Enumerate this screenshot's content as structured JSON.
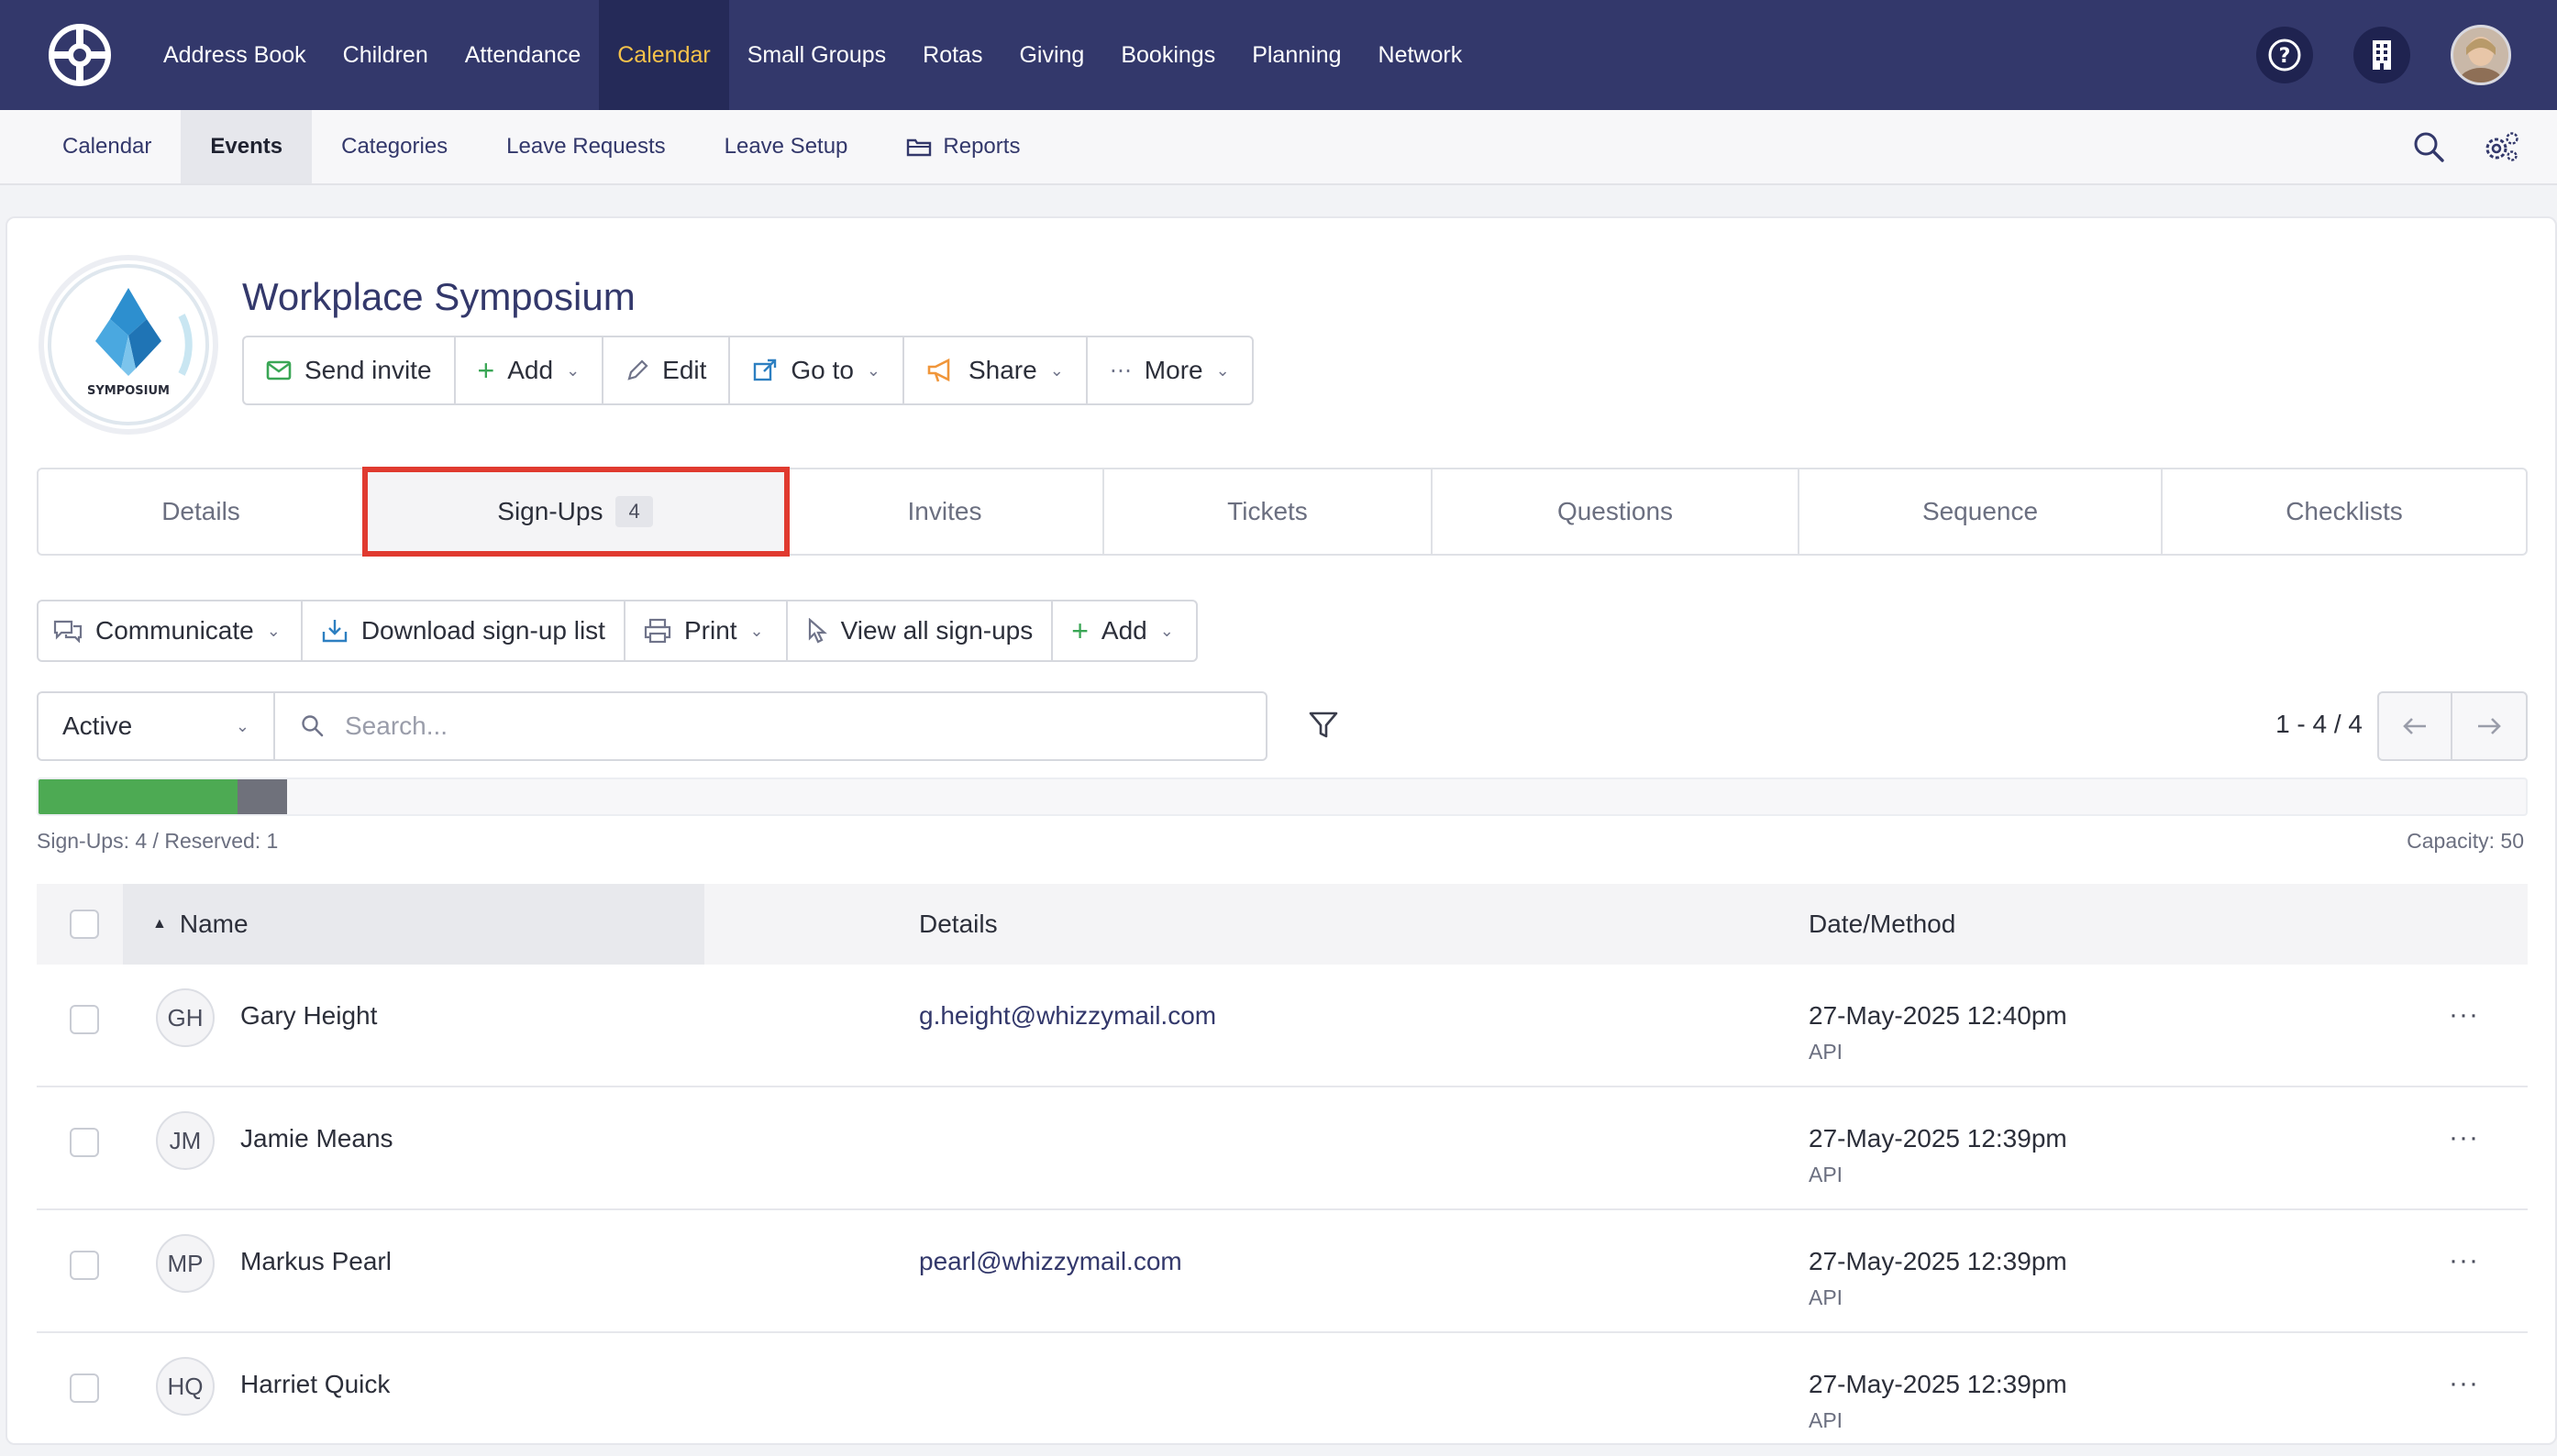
{
  "topnav": {
    "items": [
      "Address Book",
      "Children",
      "Attendance",
      "Calendar",
      "Small Groups",
      "Rotas",
      "Giving",
      "Bookings",
      "Planning",
      "Network"
    ],
    "active": "Calendar",
    "icons": [
      "help-icon",
      "building-icon",
      "user-avatar"
    ]
  },
  "subnav": {
    "items": [
      "Calendar",
      "Events",
      "Categories",
      "Leave Requests",
      "Leave Setup",
      "Reports"
    ],
    "active": "Events",
    "tools": [
      "search-icon",
      "settings-icon"
    ]
  },
  "event": {
    "title": "Workplace Symposium",
    "logo_text": "SYMPOSIUM"
  },
  "actions": {
    "send_invite": "Send invite",
    "add": "Add",
    "edit": "Edit",
    "go_to": "Go to",
    "share": "Share",
    "more": "More"
  },
  "tabs": {
    "details": "Details",
    "signups": "Sign-Ups",
    "signups_count": "4",
    "invites": "Invites",
    "tickets": "Tickets",
    "questions": "Questions",
    "sequence": "Sequence",
    "checklists": "Checklists"
  },
  "signup_tools": {
    "communicate": "Communicate",
    "download": "Download sign-up list",
    "print": "Print",
    "view_all": "View all sign-ups",
    "add": "Add"
  },
  "filter": {
    "status": "Active",
    "search_placeholder": "Search...",
    "pager": "1 - 4 / 4"
  },
  "capacity": {
    "signups": 4,
    "reserved": 1,
    "capacity": 50,
    "label_left": "Sign-Ups: 4 / Reserved: 1",
    "label_right": "Capacity: 50",
    "signup_color": "#4daa53",
    "reserved_color": "#6f717b"
  },
  "table": {
    "headers": {
      "name": "Name",
      "details": "Details",
      "date": "Date/Method"
    },
    "rows": [
      {
        "initials": "GH",
        "name": "Gary Height",
        "email": "g.height@whizzymail.com",
        "date": "27-May-2025 12:40pm",
        "method": "API"
      },
      {
        "initials": "JM",
        "name": "Jamie Means",
        "email": "",
        "date": "27-May-2025 12:39pm",
        "method": "API"
      },
      {
        "initials": "MP",
        "name": "Markus Pearl",
        "email": "pearl@whizzymail.com",
        "date": "27-May-2025 12:39pm",
        "method": "API"
      },
      {
        "initials": "HQ",
        "name": "Harriet Quick",
        "email": "",
        "date": "27-May-2025 12:39pm",
        "method": "API"
      }
    ]
  },
  "colors": {
    "nav_bg": "#33386b",
    "nav_active_text": "#f6c24a",
    "highlight_border": "#e03a2f"
  }
}
